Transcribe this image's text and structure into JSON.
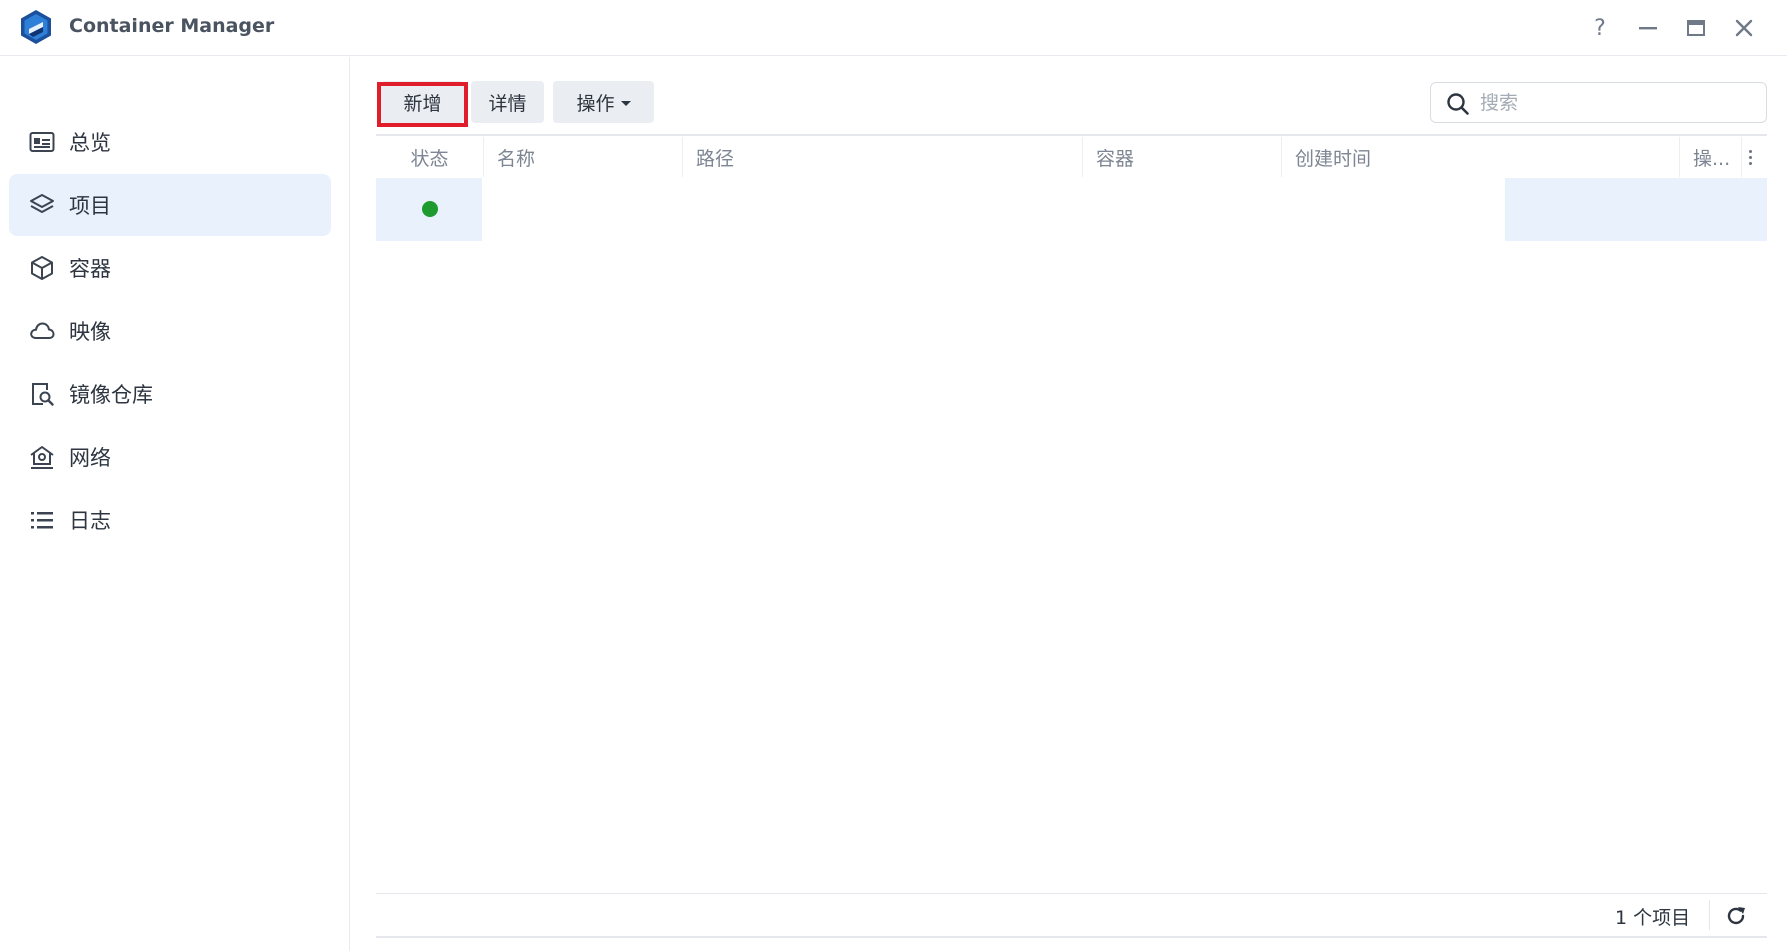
{
  "window": {
    "title": "Container Manager",
    "help_label": "?"
  },
  "sidebar": {
    "items": [
      {
        "label": "总览",
        "icon": "overview-card-icon",
        "active": false
      },
      {
        "label": "项目",
        "icon": "layers-icon",
        "active": true
      },
      {
        "label": "容器",
        "icon": "cube-icon",
        "active": false
      },
      {
        "label": "映像",
        "icon": "cloud-icon",
        "active": false
      },
      {
        "label": "镜像仓库",
        "icon": "registry-search-icon",
        "active": false
      },
      {
        "label": "网络",
        "icon": "network-home-icon",
        "active": false
      },
      {
        "label": "日志",
        "icon": "list-icon",
        "active": false
      }
    ]
  },
  "toolbar": {
    "add_label": "新增",
    "details_label": "详情",
    "action_label": "操作"
  },
  "search": {
    "placeholder": "搜索",
    "value": ""
  },
  "table": {
    "columns": [
      "状态",
      "名称",
      "路径",
      "容器",
      "创建时间",
      "操..."
    ],
    "rows": [
      {
        "status": "running",
        "status_color": "#1e9b2f",
        "name": "",
        "path": "",
        "containers": "",
        "created": ""
      }
    ]
  },
  "footer": {
    "count_label": "1 个项目"
  },
  "colors": {
    "accent": "#e9f1fd",
    "highlight": "#e01e2b",
    "status_running": "#1e9b2f"
  }
}
